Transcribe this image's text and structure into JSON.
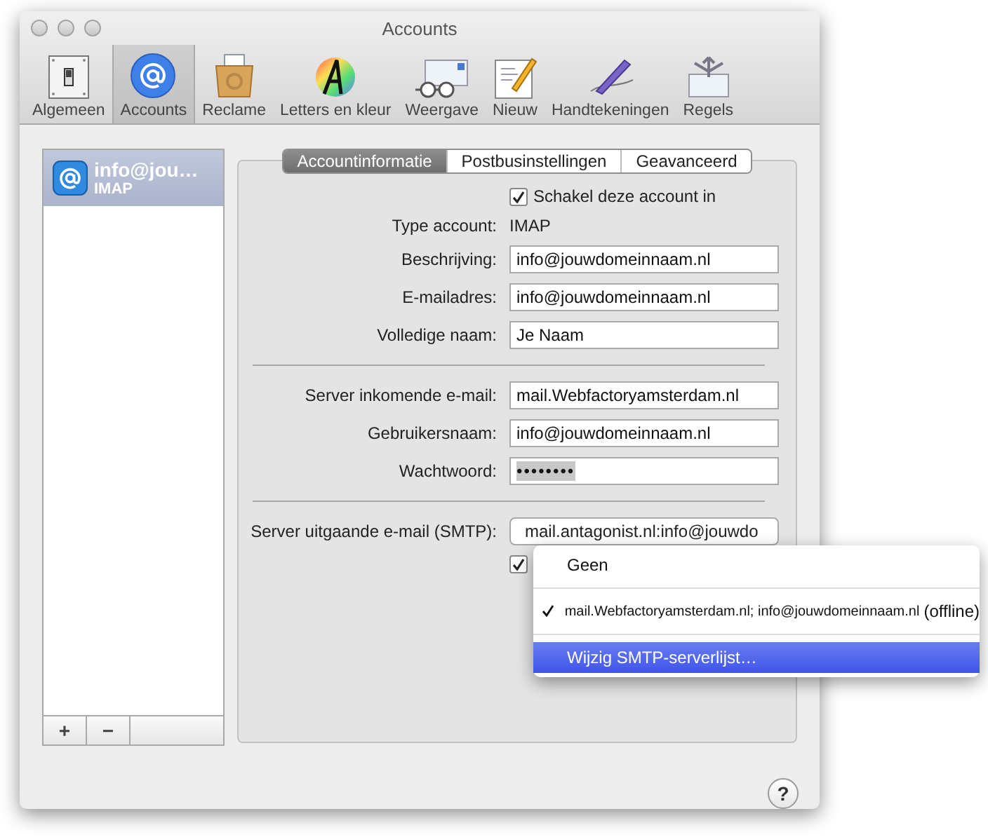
{
  "window": {
    "title": "Accounts"
  },
  "toolbar": [
    {
      "label": "Algemeen",
      "kind": "switch",
      "selected": false
    },
    {
      "label": "Accounts",
      "kind": "at",
      "selected": true
    },
    {
      "label": "Reclame",
      "kind": "box",
      "selected": false
    },
    {
      "label": "Letters en kleur",
      "kind": "font",
      "selected": false
    },
    {
      "label": "Weergave",
      "kind": "glasses",
      "selected": false
    },
    {
      "label": "Nieuw",
      "kind": "pad",
      "selected": false
    },
    {
      "label": "Handtekeningen",
      "kind": "pen",
      "selected": false
    },
    {
      "label": "Regels",
      "kind": "rules",
      "selected": false
    }
  ],
  "accounts": [
    {
      "name": "info@jou…",
      "type": "IMAP",
      "selected": true
    }
  ],
  "list_buttons": [
    "+",
    "−"
  ],
  "tabs": [
    {
      "label": "Accountinformatie",
      "selected": true
    },
    {
      "label": "Postbusinstellingen",
      "selected": false
    },
    {
      "label": "Geavanceerd",
      "selected": false
    }
  ],
  "enable_account": {
    "label": "Schakel deze account in",
    "checked": true
  },
  "account_type": {
    "label": "Type account:",
    "value": "IMAP"
  },
  "fields_personal": [
    {
      "label": "Beschrijving:",
      "value": "info@jouwdomeinnaam.nl"
    },
    {
      "label": "E-mailadres:",
      "value": "info@jouwdomeinnaam.nl"
    },
    {
      "label": "Volledige naam:",
      "value": "Je Naam"
    }
  ],
  "fields_server": [
    {
      "label": "Server inkomende e-mail:",
      "value": "mail.Webfactoryamsterdam.nl",
      "kind": "text"
    },
    {
      "label": "Gebruikersnaam:",
      "value": "info@jouwdomeinnaam.nl",
      "kind": "text"
    },
    {
      "label": "Wachtwoord:",
      "value": "••••••••",
      "kind": "password"
    }
  ],
  "smtp": {
    "label": "Server uitgaande e-mail (SMTP):",
    "value": "mail.antagonist.nl:info@jouwdo"
  },
  "use_only_this_server": {
    "checked": true
  },
  "smtp_menu": [
    {
      "kind": "item",
      "label": "Geen",
      "checked": false,
      "selected": false
    },
    {
      "kind": "separator"
    },
    {
      "kind": "item",
      "label": "mail.Webfactoryamsterdam.nl; info@jouwdomeinnaam.nl",
      "status": "(offline)",
      "checked": true,
      "selected": false
    },
    {
      "kind": "separator"
    },
    {
      "kind": "item",
      "label": "Wijzig SMTP-serverlijst…",
      "checked": false,
      "selected": true
    }
  ],
  "help": {
    "label": "?"
  }
}
